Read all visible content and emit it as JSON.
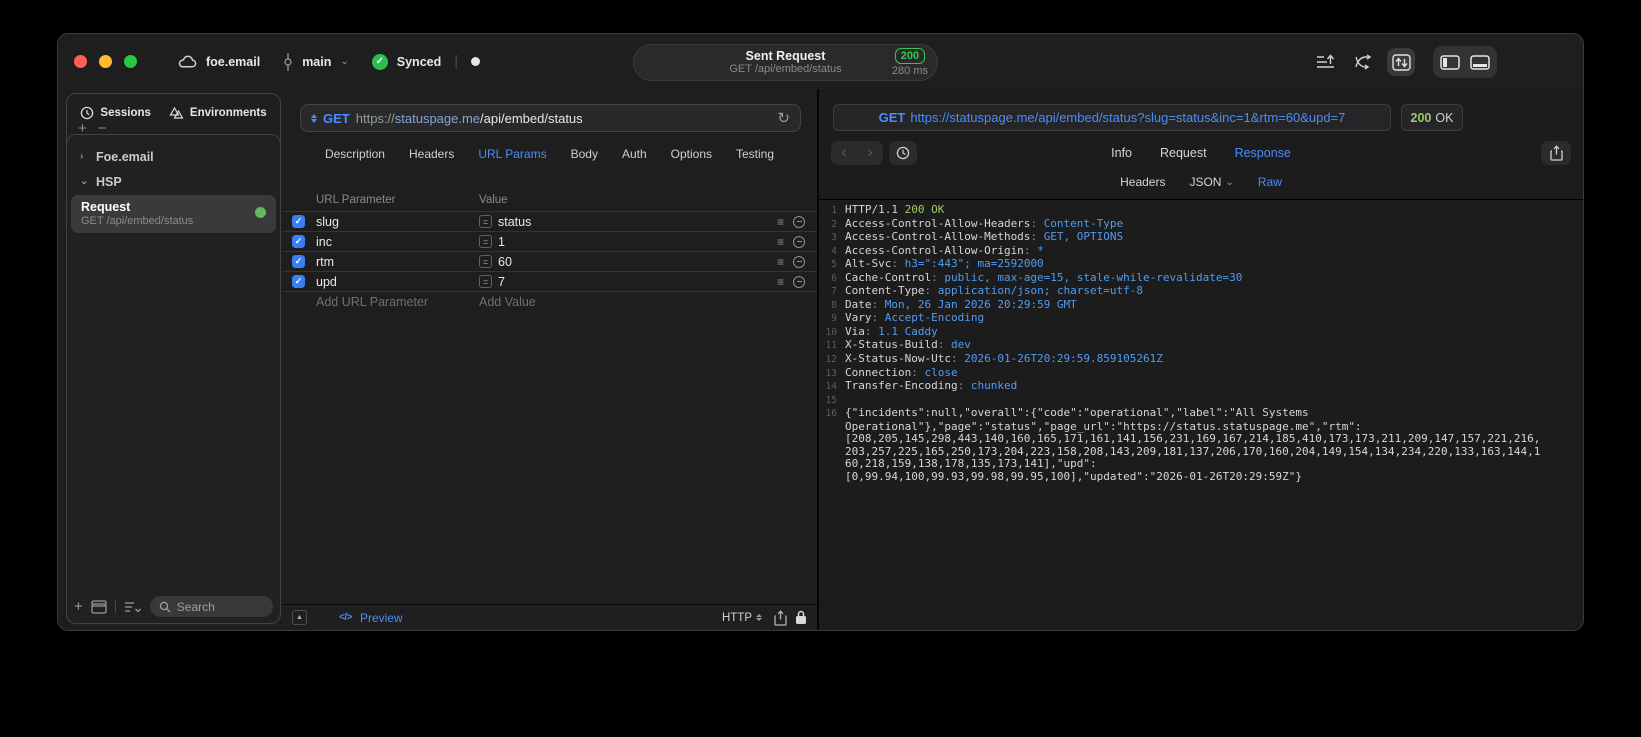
{
  "titlebar": {
    "project_name": "foe.email",
    "branch_name": "main",
    "sync_label": "Synced",
    "request_pill": {
      "title": "Sent Request",
      "subtitle": "GET /api/embed/status",
      "status_code": "200",
      "duration": "280 ms"
    }
  },
  "sidebar": {
    "tabs": [
      {
        "label": "Sessions"
      },
      {
        "label": "Environments"
      }
    ],
    "groups": [
      {
        "label": "Foe.email",
        "chevron": "›"
      },
      {
        "label": "HSP",
        "chevron": "⌄"
      }
    ],
    "request_item": {
      "title": "Request",
      "subtitle": "GET /api/embed/status"
    },
    "search_placeholder": "Search"
  },
  "request_editor": {
    "method": "GET",
    "url": {
      "scheme": "https://",
      "host": "statuspage.me",
      "path": "/api/embed/status"
    },
    "tabs": [
      "Description",
      "Headers",
      "URL Params",
      "Body",
      "Auth",
      "Options",
      "Testing"
    ],
    "active_tab": "URL Params",
    "params_table": {
      "columns": [
        "URL Parameter",
        "Value"
      ],
      "rows": [
        {
          "name": "slug",
          "value": "status",
          "checked": true
        },
        {
          "name": "inc",
          "value": "1",
          "checked": true
        },
        {
          "name": "rtm",
          "value": "60",
          "checked": true
        },
        {
          "name": "upd",
          "value": "7",
          "checked": true
        }
      ],
      "add_row": {
        "name_placeholder": "Add URL Parameter",
        "value_placeholder": "Add Value"
      }
    },
    "footer": {
      "code_icon": "</>",
      "preview_label": "Preview",
      "http_label": "HTTP"
    }
  },
  "response_viewer": {
    "method": "GET",
    "url": "https://statuspage.me/api/embed/status?slug=status&inc=1&rtm=60&upd=7",
    "status_code": "200",
    "status_text": "OK",
    "tabs": [
      "Info",
      "Request",
      "Response"
    ],
    "active_tab": "Response",
    "subtabs": [
      "Headers",
      "JSON",
      "Raw"
    ],
    "active_subtab": "Raw",
    "lines": [
      {
        "num": "1",
        "segs": [
          {
            "t": "HTTP/1.1 ",
            "c": "plain"
          },
          {
            "t": "200 OK",
            "c": "green"
          }
        ]
      },
      {
        "num": "2",
        "segs": [
          {
            "t": "Access-Control-Allow-Headers",
            "c": "plain"
          },
          {
            "t": ": ",
            "c": "muted"
          },
          {
            "t": "Content-Type",
            "c": "blue"
          }
        ]
      },
      {
        "num": "3",
        "segs": [
          {
            "t": "Access-Control-Allow-Methods",
            "c": "plain"
          },
          {
            "t": ": ",
            "c": "muted"
          },
          {
            "t": "GET, OPTIONS",
            "c": "blue"
          }
        ]
      },
      {
        "num": "4",
        "segs": [
          {
            "t": "Access-Control-Allow-Origin",
            "c": "plain"
          },
          {
            "t": ": ",
            "c": "muted"
          },
          {
            "t": "*",
            "c": "blue"
          }
        ]
      },
      {
        "num": "5",
        "segs": [
          {
            "t": "Alt-Svc",
            "c": "plain"
          },
          {
            "t": ": ",
            "c": "muted"
          },
          {
            "t": "h3=\":443\"; ma=2592000",
            "c": "blue"
          }
        ]
      },
      {
        "num": "6",
        "segs": [
          {
            "t": "Cache-Control",
            "c": "plain"
          },
          {
            "t": ": ",
            "c": "muted"
          },
          {
            "t": "public, max-age=15, stale-while-revalidate=30",
            "c": "blue"
          }
        ]
      },
      {
        "num": "7",
        "segs": [
          {
            "t": "Content-Type",
            "c": "plain"
          },
          {
            "t": ": ",
            "c": "muted"
          },
          {
            "t": "application/json; charset=utf-8",
            "c": "blue"
          }
        ]
      },
      {
        "num": "8",
        "segs": [
          {
            "t": "Date",
            "c": "plain"
          },
          {
            "t": ": ",
            "c": "muted"
          },
          {
            "t": "Mon, 26 Jan 2026 20:29:59 GMT",
            "c": "blue"
          }
        ]
      },
      {
        "num": "9",
        "segs": [
          {
            "t": "Vary",
            "c": "plain"
          },
          {
            "t": ": ",
            "c": "muted"
          },
          {
            "t": "Accept-Encoding",
            "c": "blue"
          }
        ]
      },
      {
        "num": "10",
        "segs": [
          {
            "t": "Via",
            "c": "plain"
          },
          {
            "t": ": ",
            "c": "muted"
          },
          {
            "t": "1.1 Caddy",
            "c": "blue"
          }
        ]
      },
      {
        "num": "11",
        "segs": [
          {
            "t": "X-Status-Build",
            "c": "plain"
          },
          {
            "t": ": ",
            "c": "muted"
          },
          {
            "t": "dev",
            "c": "blue"
          }
        ]
      },
      {
        "num": "12",
        "segs": [
          {
            "t": "X-Status-Now-Utc",
            "c": "plain"
          },
          {
            "t": ": ",
            "c": "muted"
          },
          {
            "t": "2026-01-26T20:29:59.859105261Z",
            "c": "blue"
          }
        ]
      },
      {
        "num": "13",
        "segs": [
          {
            "t": "Connection",
            "c": "plain"
          },
          {
            "t": ": ",
            "c": "muted"
          },
          {
            "t": "close",
            "c": "blue"
          }
        ]
      },
      {
        "num": "14",
        "segs": [
          {
            "t": "Transfer-Encoding",
            "c": "plain"
          },
          {
            "t": ": ",
            "c": "muted"
          },
          {
            "t": "chunked",
            "c": "blue"
          }
        ]
      },
      {
        "num": "15",
        "segs": []
      },
      {
        "num": "16",
        "segs": [
          {
            "t": "{\"incidents\":null,\"overall\":{\"code\":\"operational\",\"label\":\"All Systems",
            "c": "plain"
          }
        ]
      },
      {
        "num": "",
        "segs": [
          {
            "t": "Operational\"},\"page\":\"status\",\"page_url\":\"https://status.statuspage.me\",\"rtm\":",
            "c": "plain"
          }
        ]
      },
      {
        "num": "",
        "segs": [
          {
            "t": "[208,205,145,298,443,140,160,165,171,161,141,156,231,169,167,214,185,410,173,173,211,209,147,157,221,216,",
            "c": "plain"
          }
        ]
      },
      {
        "num": "",
        "segs": [
          {
            "t": "203,257,225,165,250,173,204,223,158,208,143,209,181,137,206,170,160,204,149,154,134,234,220,133,163,144,1",
            "c": "plain"
          }
        ]
      },
      {
        "num": "",
        "segs": [
          {
            "t": "60,218,159,138,178,135,173,141],\"upd\":",
            "c": "plain"
          }
        ]
      },
      {
        "num": "",
        "segs": [
          {
            "t": "[0,99.94,100,99.93,99.98,99.95,100],\"updated\":\"2026-01-26T20:29:59Z\"}",
            "c": "plain"
          }
        ]
      }
    ]
  },
  "colors": {
    "accent_blue": "#4b8df8",
    "badge_green": "#32c74e",
    "ok_green": "#9dc968",
    "value_blue": "#4f9df2",
    "online_dot_green": "#63b863"
  }
}
